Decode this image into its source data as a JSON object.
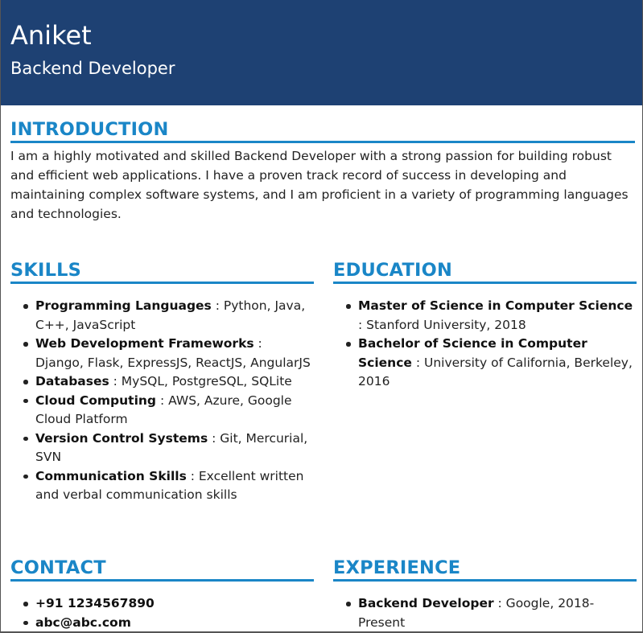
{
  "header": {
    "name": "Aniket",
    "role": "Backend Developer",
    "bg_color": "#1e4173"
  },
  "accent_color": "#1a86c7",
  "introduction": {
    "title": "INTRODUCTION",
    "text": "I am a highly motivated and skilled Backend Developer with a strong passion for building robust and efficient web applications. I have a proven track record of success in developing and maintaining complex software systems, and I am proficient in a variety of programming languages and technologies."
  },
  "skills": {
    "title": "SKILLS",
    "items": [
      {
        "key": "Programming Languages",
        "value": " : Python, Java, C++, JavaScript"
      },
      {
        "key": "Web Development Frameworks",
        "value": " : Django, Flask, ExpressJS, ReactJS, AngularJS"
      },
      {
        "key": "Databases",
        "value": " : MySQL, PostgreSQL, SQLite"
      },
      {
        "key": "Cloud Computing",
        "value": " : AWS, Azure, Google Cloud Platform"
      },
      {
        "key": "Version Control Systems",
        "value": " : Git, Mercurial, SVN"
      },
      {
        "key": "Communication Skills",
        "value": " : Excellent written and verbal communication skills"
      }
    ]
  },
  "education": {
    "title": "EDUCATION",
    "items": [
      {
        "key": "Master of Science in Computer Science",
        "value": " : Stanford University, 2018"
      },
      {
        "key": "Bachelor of Science in Computer Science",
        "value": " : University of California, Berkeley, 2016"
      }
    ]
  },
  "contact": {
    "title": "CONTACT",
    "items": [
      {
        "key": "+91 1234567890",
        "value": ""
      },
      {
        "key": "abc@abc.com",
        "value": ""
      }
    ]
  },
  "experience": {
    "title": "EXPERIENCE",
    "items": [
      {
        "key": "Backend Developer",
        "value": " : Google, 2018-Present"
      }
    ]
  }
}
